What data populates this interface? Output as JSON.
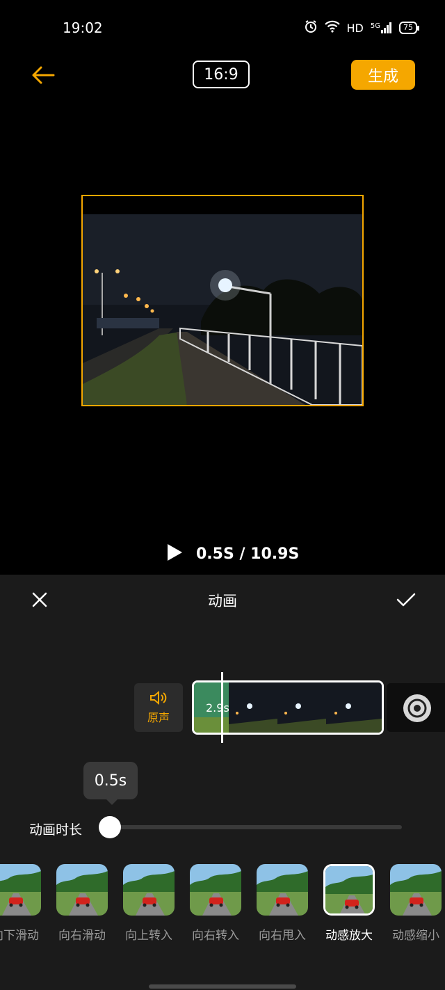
{
  "status_bar": {
    "time": "19:02",
    "network": "HD",
    "signal": "5G",
    "battery": "75"
  },
  "top_bar": {
    "aspect_ratio": "16:9",
    "generate_label": "生成"
  },
  "playback": {
    "time": "0.5S / 10.9S"
  },
  "panel": {
    "title": "动画"
  },
  "timeline": {
    "original_sound_label": "原声",
    "clip_duration": "2.9s"
  },
  "slider": {
    "label": "动画时长",
    "value": "0.5s",
    "level": 0
  },
  "presets": [
    {
      "label": "向下滑动",
      "selected": false
    },
    {
      "label": "向右滑动",
      "selected": false
    },
    {
      "label": "向上转入",
      "selected": false
    },
    {
      "label": "向右转入",
      "selected": false
    },
    {
      "label": "向右甩入",
      "selected": false
    },
    {
      "label": "动感放大",
      "selected": true
    },
    {
      "label": "动感缩小",
      "selected": false
    }
  ],
  "colors": {
    "accent": "#f5a700",
    "panel_bg": "#1b1b1b"
  }
}
